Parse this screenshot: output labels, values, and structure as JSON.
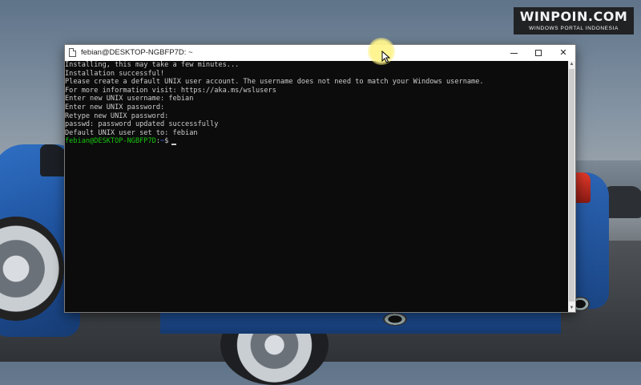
{
  "watermark": {
    "title": "WINPOIN.COM",
    "subtitle": "WINDOWS PORTAL INDONESIA"
  },
  "window": {
    "title": "febian@DESKTOP-NGBFP7D: ~",
    "controls": {
      "minimize_icon": "minimize-icon",
      "maximize_icon": "maximize-icon",
      "close_icon": "close-icon"
    }
  },
  "console": {
    "lines": [
      "Installing, this may take a few minutes...",
      "Installation successful!",
      "Please create a default UNIX user account. The username does not need to match your Windows username.",
      "For more information visit: https://aka.ms/wslusers",
      "Enter new UNIX username: febian",
      "Enter new UNIX password:",
      "Retype new UNIX password:",
      "passwd: password updated successfully",
      "Default UNIX user set to: febian"
    ],
    "prompt": {
      "user_host": "febian@DESKTOP-NGBFP7D",
      "separator": ":",
      "path": "~",
      "symbol": "$"
    }
  },
  "colors": {
    "terminal_bg": "#0c0c0c",
    "terminal_text": "#cccccc",
    "prompt_user": "#16c60c",
    "prompt_path": "#3b78ff",
    "titlebar": "#ffffff"
  }
}
